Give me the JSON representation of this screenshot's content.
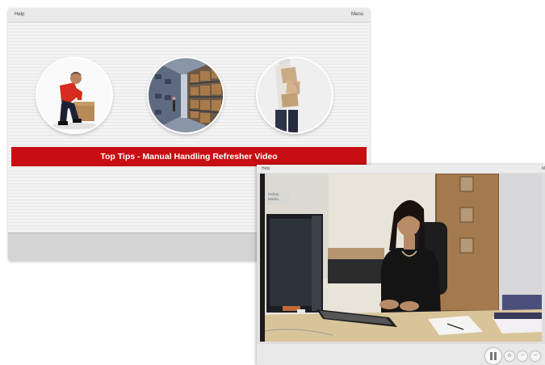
{
  "back_window": {
    "help_label": "Help",
    "menu_label": "Menu",
    "banner_title": "Top Tips - Manual Handling Refresher Video",
    "thumbnails": [
      {
        "name": "person-lifting-box"
      },
      {
        "name": "warehouse-shelves"
      },
      {
        "name": "person-carrying-boxes"
      }
    ]
  },
  "front_window": {
    "help_label": "Help",
    "menu_label": "M",
    "video_watermark": "Safety Media",
    "controls": {
      "pause_icon": "pause-icon",
      "small_buttons": [
        "o",
        "−",
        "−"
      ]
    }
  },
  "colors": {
    "banner": "#c70f13",
    "window_bg": "#d9d9d9"
  }
}
